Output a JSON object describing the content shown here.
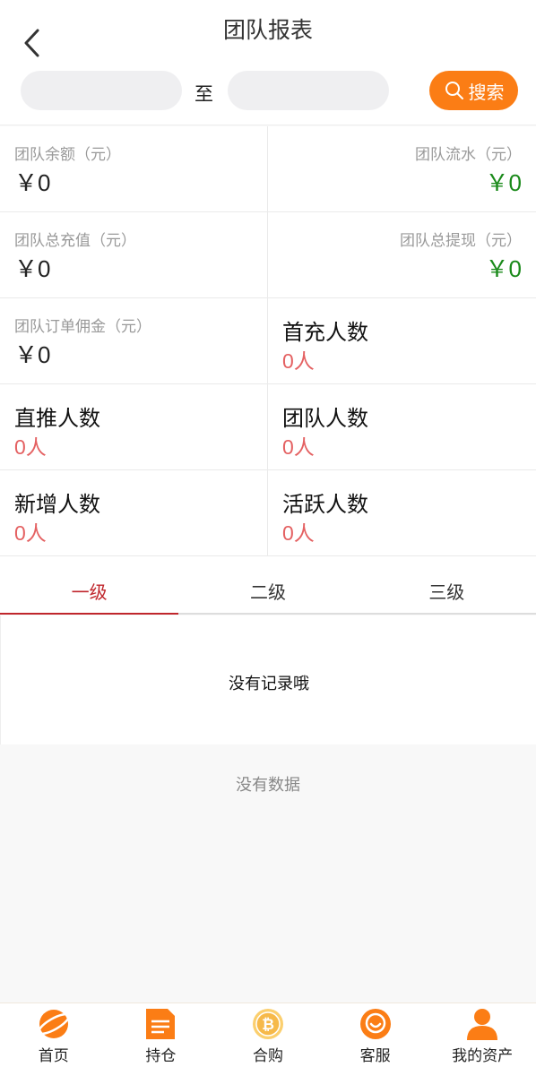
{
  "header": {
    "title": "团队报表",
    "date_separator": "至",
    "search_label": "搜索"
  },
  "stats": {
    "team_balance": {
      "label": "团队余额（元）",
      "value": "￥0"
    },
    "team_flow": {
      "label": "团队流水（元）",
      "value": "￥0"
    },
    "team_recharge": {
      "label": "团队总充值（元）",
      "value": "￥0"
    },
    "team_withdraw": {
      "label": "团队总提现（元）",
      "value": "￥0"
    },
    "team_commission": {
      "label": "团队订单佣金（元）",
      "value": "￥0"
    },
    "first_recharge": {
      "label": "首充人数",
      "value": "0人"
    },
    "direct": {
      "label": "直推人数",
      "value": "0人"
    },
    "team_count": {
      "label": "团队人数",
      "value": "0人"
    },
    "new_count": {
      "label": "新增人数",
      "value": "0人"
    },
    "active_count": {
      "label": "活跃人数",
      "value": "0人"
    }
  },
  "tabs": [
    "一级",
    "二级",
    "三级"
  ],
  "empty_record": "没有记录哦",
  "no_data": "没有数据",
  "tabbar": [
    {
      "label": "首页",
      "icon": "planet-icon"
    },
    {
      "label": "持仓",
      "icon": "document-icon"
    },
    {
      "label": "合购",
      "icon": "bitcoin-icon"
    },
    {
      "label": "客服",
      "icon": "chat-icon"
    },
    {
      "label": "我的资产",
      "icon": "user-icon"
    }
  ],
  "colors": {
    "accent": "#fb7d15",
    "positive": "#1a8a1a",
    "count": "#e46162",
    "active_tab": "#c0262c"
  }
}
